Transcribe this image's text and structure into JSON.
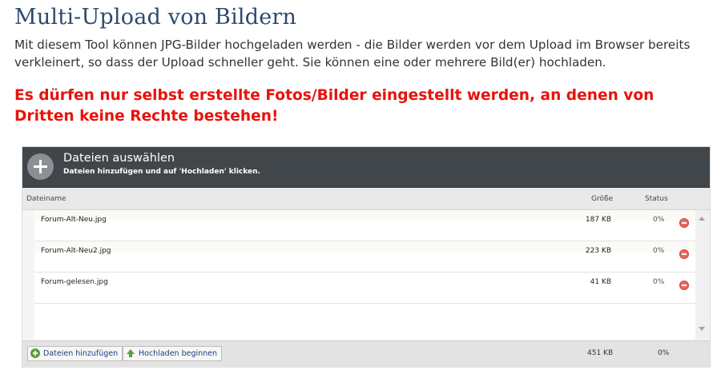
{
  "page": {
    "title": "Multi-Upload von Bildern",
    "intro": "Mit diesem Tool können JPG-Bilder hochgeladen werden - die Bilder werden vor dem Upload im Browser bereits verkleinert, so dass der Upload schneller geht. Sie können eine oder mehrere Bild(er) hochladen.",
    "warning": "Es dürfen nur selbst erstellte Fotos/Bilder eingestellt werden, an denen von Dritten keine Rechte bestehen!"
  },
  "uploader": {
    "header_title": "Dateien auswählen",
    "header_subtitle": "Dateien hinzufügen und auf 'Hochladen' klicken.",
    "add_icon": "plus-circle-icon",
    "columns": {
      "name": "Dateiname",
      "size": "Größe",
      "status": "Status"
    },
    "files": [
      {
        "name": "Forum-Alt-Neu.jpg",
        "size": "187 KB",
        "status": "0%"
      },
      {
        "name": "Forum-Alt-Neu2.jpg",
        "size": "223 KB",
        "status": "0%"
      },
      {
        "name": "Forum-gelesen.jpg",
        "size": "41 KB",
        "status": "0%"
      }
    ],
    "footer": {
      "add_button": "Dateien hinzufügen",
      "start_button": "Hochladen beginnen",
      "total_size": "451 KB",
      "total_status": "0%"
    }
  },
  "colors": {
    "title": "#2c4a6e",
    "warning": "#e8120c",
    "header_bg": "#41464a",
    "button_text": "#1c3f7a",
    "remove_icon": "#e86a5c",
    "add_icon": "#5aa03a"
  }
}
